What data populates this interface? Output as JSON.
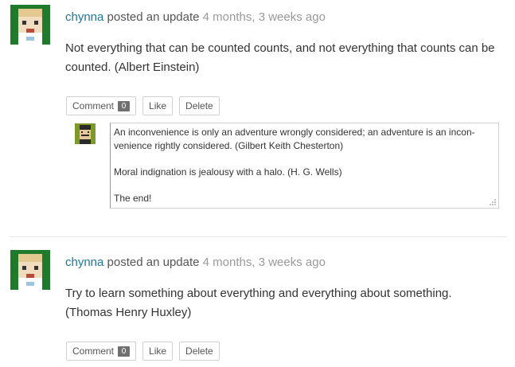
{
  "activities": [
    {
      "user": "chynna",
      "action": "posted an update",
      "time": "4 months, 3 weeks ago",
      "text": "Not everything that can be counted counts, and not everything that counts can be counted. (Albert Einstein)",
      "buttons": {
        "comment_label": "Comment",
        "comment_count": "0",
        "like_label": "Like",
        "delete_label": "Delete"
      },
      "reply": {
        "lines": [
          "An inconvenience is only an adventure wrongly considered; an adventure is an incon-venience rightly considered. (Gilbert Keith Chesterton)",
          "Moral indignation is jealousy with a halo. (H. G. Wells)",
          "The end!"
        ]
      }
    },
    {
      "user": "chynna",
      "action": "posted an update",
      "time": "4 months, 3 weeks ago",
      "text": "Try to learn something about everything and everything about something. (Thomas Henry Huxley)",
      "buttons": {
        "comment_label": "Comment",
        "comment_count": "0",
        "like_label": "Like",
        "delete_label": "Delete"
      }
    }
  ],
  "colors": {
    "link": "#20769b",
    "time": "#9a9a9a",
    "avatar_bg": "#1f7a2c",
    "count_bg": "#707070"
  },
  "icons": {
    "user_avatar": "pixel-face-avatar",
    "reply_avatar": "pixel-mustache-avatar",
    "resize": "resize-grip-icon"
  }
}
